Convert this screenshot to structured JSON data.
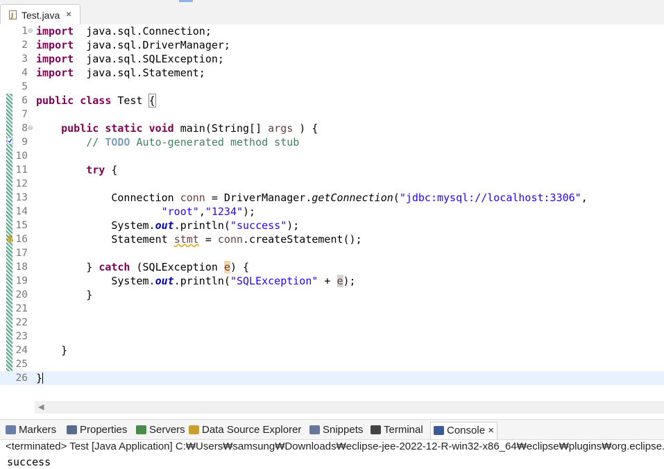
{
  "editor_tab": {
    "label": "Test.java",
    "close": "×"
  },
  "lines": [
    {
      "n": "1",
      "fold": "⊖",
      "parts": [
        [
          "kw",
          "import"
        ],
        [
          "",
          "  java.sql.Connection;"
        ]
      ]
    },
    {
      "n": "2",
      "parts": [
        [
          "kw",
          "import"
        ],
        [
          "",
          "  java.sql.DriverManager;"
        ]
      ]
    },
    {
      "n": "3",
      "parts": [
        [
          "kw",
          "import"
        ],
        [
          "",
          "  java.sql.SQLException;"
        ]
      ]
    },
    {
      "n": "4",
      "parts": [
        [
          "kw",
          "import"
        ],
        [
          "",
          "  java.sql.Statement;"
        ]
      ]
    },
    {
      "n": "5",
      "parts": []
    },
    {
      "n": "6",
      "parts": [
        [
          "kw",
          "public"
        ],
        [
          "",
          " "
        ],
        [
          "kw",
          "class"
        ],
        [
          "",
          " Test "
        ],
        [
          "bracebox",
          "{"
        ]
      ]
    },
    {
      "n": "7",
      "parts": []
    },
    {
      "n": "8",
      "fold": "⊖",
      "parts": [
        [
          "",
          "    "
        ],
        [
          "kw",
          "public"
        ],
        [
          "",
          " "
        ],
        [
          "kw",
          "static"
        ],
        [
          "",
          " "
        ],
        [
          "kw",
          "void"
        ],
        [
          "",
          " main(String[] "
        ],
        [
          "var",
          "args"
        ],
        [
          "",
          " ) {"
        ]
      ]
    },
    {
      "n": "9",
      "parts": [
        [
          "",
          "        "
        ],
        [
          "com",
          "// "
        ],
        [
          "todo",
          "TODO"
        ],
        [
          "com",
          " Auto-generated method stub"
        ]
      ]
    },
    {
      "n": "10",
      "parts": []
    },
    {
      "n": "11",
      "parts": [
        [
          "",
          "        "
        ],
        [
          "kw",
          "try"
        ],
        [
          "",
          " {"
        ]
      ]
    },
    {
      "n": "12",
      "parts": []
    },
    {
      "n": "13",
      "parts": [
        [
          "",
          "            Connection "
        ],
        [
          "var",
          "conn"
        ],
        [
          "",
          " = DriverManager."
        ],
        [
          "stat",
          "getConnection"
        ],
        [
          "",
          "("
        ],
        [
          "str",
          "\"jdbc:mysql://localhost:3306\""
        ],
        [
          "",
          ","
        ]
      ]
    },
    {
      "n": "14",
      "parts": [
        [
          "",
          "                    "
        ],
        [
          "str",
          "\"root\""
        ],
        [
          "",
          ","
        ],
        [
          "str",
          "\"1234\""
        ],
        [
          "",
          ");"
        ]
      ]
    },
    {
      "n": "15",
      "parts": [
        [
          "",
          "            System."
        ],
        [
          "fld",
          "out"
        ],
        [
          "",
          ".println("
        ],
        [
          "str",
          "\"success\""
        ],
        [
          "",
          ");"
        ]
      ]
    },
    {
      "n": "16",
      "parts": [
        [
          "",
          "            Statement "
        ],
        [
          "var warn",
          "stmt"
        ],
        [
          "",
          " = "
        ],
        [
          "var",
          "conn"
        ],
        [
          "",
          ".createStatement();"
        ]
      ]
    },
    {
      "n": "17",
      "parts": []
    },
    {
      "n": "18",
      "parts": [
        [
          "",
          "        } "
        ],
        [
          "kw",
          "catch"
        ],
        [
          "",
          " (SQLException "
        ],
        [
          "var hlw",
          "e"
        ],
        [
          "",
          ") {"
        ]
      ]
    },
    {
      "n": "19",
      "parts": [
        [
          "",
          "            System."
        ],
        [
          "fld",
          "out"
        ],
        [
          "",
          ".println("
        ],
        [
          "str",
          "\"SQLException\""
        ],
        [
          "",
          " + "
        ],
        [
          "var hl",
          "e"
        ],
        [
          "",
          ");"
        ]
      ]
    },
    {
      "n": "20",
      "parts": [
        [
          "",
          "        }"
        ]
      ]
    },
    {
      "n": "21",
      "parts": []
    },
    {
      "n": "22",
      "parts": []
    },
    {
      "n": "23",
      "parts": []
    },
    {
      "n": "24",
      "parts": [
        [
          "",
          "    }"
        ]
      ]
    },
    {
      "n": "25",
      "parts": []
    },
    {
      "n": "26",
      "parts": [
        [
          "",
          "}"
        ]
      ],
      "current": true
    }
  ],
  "bottom_tabs": [
    {
      "label": "Markers",
      "icon": "markers-icon",
      "color": "#6b7ea8"
    },
    {
      "label": "Properties",
      "icon": "properties-icon",
      "color": "#5a6b8c"
    },
    {
      "label": "Servers",
      "icon": "servers-icon",
      "color": "#4a8a4a"
    },
    {
      "label": "Data Source Explorer",
      "icon": "data-source-icon",
      "color": "#c8a030"
    },
    {
      "label": "Snippets",
      "icon": "snippets-icon",
      "color": "#667799"
    },
    {
      "label": "Terminal",
      "icon": "terminal-icon",
      "color": "#444444"
    },
    {
      "label": "Console",
      "icon": "console-icon",
      "color": "#3a5a9a",
      "active": true,
      "close": "×"
    }
  ],
  "console": {
    "status": "<terminated> Test [Java Application] C:₩Users₩samsung₩Downloads₩eclipse-jee-2022-12-R-win32-x86_64₩eclipse₩plugins₩org.eclipse.ju",
    "output": "success"
  }
}
